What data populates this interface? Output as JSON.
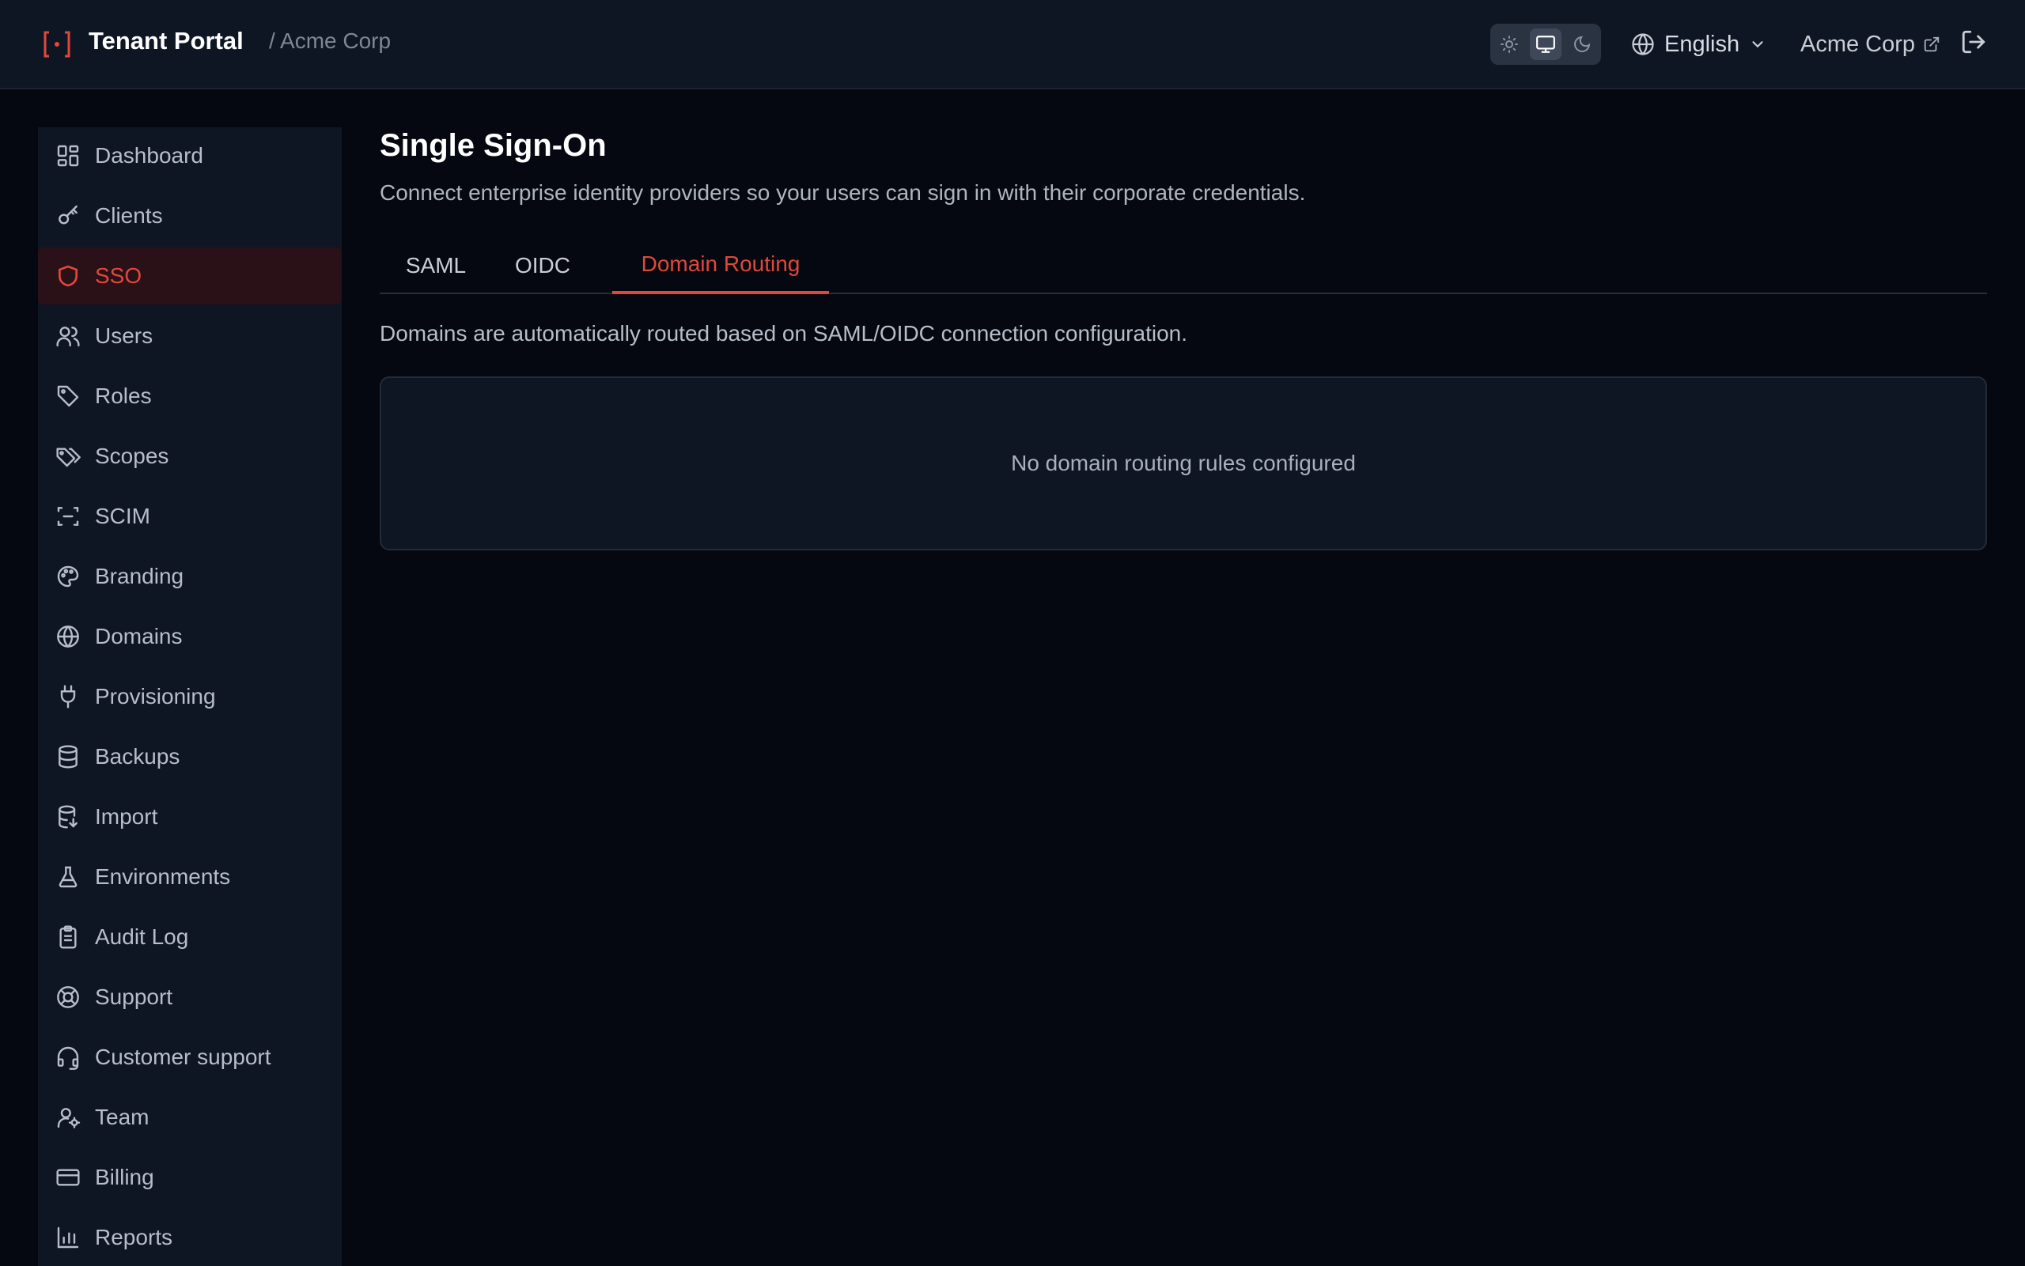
{
  "header": {
    "title": "Tenant Portal",
    "breadcrumb": "/ Acme Corp",
    "theme_options": [
      "light-mode-icon",
      "system-mode-icon",
      "dark-mode-icon"
    ],
    "theme_selected": "system",
    "language": "English",
    "tenant_name": "Acme Corp"
  },
  "sidebar": {
    "items": [
      {
        "label": "Dashboard",
        "icon": "dashboard-icon"
      },
      {
        "label": "Clients",
        "icon": "key-icon"
      },
      {
        "label": "SSO",
        "icon": "shield-icon",
        "active": true
      },
      {
        "label": "Users",
        "icon": "users-icon"
      },
      {
        "label": "Roles",
        "icon": "tag-icon"
      },
      {
        "label": "Scopes",
        "icon": "tags-icon"
      },
      {
        "label": "SCIM",
        "icon": "scan-icon"
      },
      {
        "label": "Branding",
        "icon": "palette-icon"
      },
      {
        "label": "Domains",
        "icon": "globe-icon"
      },
      {
        "label": "Provisioning",
        "icon": "plug-icon"
      },
      {
        "label": "Backups",
        "icon": "database-icon"
      },
      {
        "label": "Import",
        "icon": "database-import-icon"
      },
      {
        "label": "Environments",
        "icon": "flask-icon"
      },
      {
        "label": "Audit Log",
        "icon": "clipboard-icon"
      },
      {
        "label": "Support",
        "icon": "lifebuoy-icon"
      },
      {
        "label": "Customer support",
        "icon": "headset-icon"
      },
      {
        "label": "Team",
        "icon": "user-cog-icon"
      },
      {
        "label": "Billing",
        "icon": "credit-card-icon"
      },
      {
        "label": "Reports",
        "icon": "bar-chart-icon"
      }
    ]
  },
  "main": {
    "title": "Single Sign-On",
    "subtitle": "Connect enterprise identity providers so your users can sign in with their corporate credentials.",
    "tabs": [
      {
        "label": "SAML"
      },
      {
        "label": "OIDC"
      },
      {
        "label": "Domain Routing",
        "active": true
      }
    ],
    "description": "Domains are automatically routed based on SAML/OIDC connection configuration.",
    "empty_state": "No domain routing rules configured"
  },
  "colors": {
    "accent": "#e0483a",
    "background": "#050810",
    "panel": "#0f1623"
  }
}
